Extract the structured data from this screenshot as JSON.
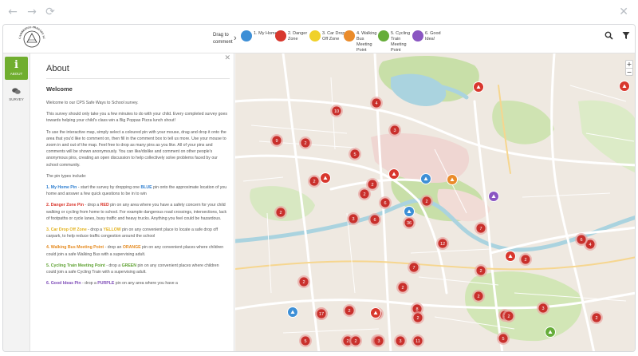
{
  "browser": {
    "back": "←",
    "forward": "→",
    "reload": "⟳",
    "close": "✕"
  },
  "header": {
    "logo_text": "CAMBRIDGE PRIMARY SCHOOL",
    "intro": "Drag to comment",
    "steps": [
      {
        "label": "1. My Home",
        "color": "#3d8fd6"
      },
      {
        "label": "2. Danger Zone",
        "color": "#d8372d"
      },
      {
        "label": "3. Car Drop Off Zone",
        "color": "#f0d12a"
      },
      {
        "label": "4. Walking Bus Meeting Point",
        "color": "#ea8b2a"
      },
      {
        "label": "5. Cycling Train Meeting Point",
        "color": "#66ad39"
      },
      {
        "label": "6. Good Idea!",
        "color": "#8a56c2"
      }
    ],
    "search_icon": "search-icon",
    "filter_icon": "filter-icon"
  },
  "sidebar": {
    "tabs": [
      {
        "label": "ABOUT",
        "icon": "info-icon"
      },
      {
        "label": "SURVEY",
        "icon": "chat-icon"
      }
    ]
  },
  "panel": {
    "close": "✕",
    "title": "About",
    "heading": "Welcome",
    "p1": "Welcome to our CPS Safe Ways to School survey.",
    "p2": "This survey should only take you a few minutes to do with your child. Every completed survey goes towards helping your child's class win a Big Poppas Pizza lunch shout!",
    "p3": "To use the interactive map, simply select a coloured pin with your mouse, drag and drop it onto the area that you'd like to comment on, then fill in the comment box to tell us more. Use your mouse to zoom in and out of the map. Feel free to drop as many pins as you like. All of your pins and comments will be shown anonymously. You can like/dislike and comment on other people's anonymous pins, creating an open discussion to help collectively solve problems faced by our school community.",
    "p4": "The pin types include:",
    "pins": [
      {
        "name": "1. My Home Pin",
        "color_word": "BLUE",
        "pre": " - start the survey by dropping one ",
        "post": " pin onto the approximate location of you home and answer a few quick questions to be in to win"
      },
      {
        "name": "2. Danger Zone Pin",
        "color_word": "RED",
        "pre": " - drop a ",
        "post": " pin on any area where you have a safety concern for your child walking or cycling from home to school. For example dangerous road crossings, intersections, lack of footpaths or cycle lanes, busy traffic and heavy trucks. Anything you feel could be hazardous."
      },
      {
        "name": "3. Car Drop Off Zone",
        "color_word": "YELLOW",
        "pre": " - drop a ",
        "post": " pin on any convenient place to locate a safe drop off carpark, to help reduce traffic congestion around the school"
      },
      {
        "name": "4. Walking Bus Meeting Point",
        "color_word": "ORANGE",
        "pre": " - drop an ",
        "post": " pin on any convenient places where children could join a safe Walking Bus with a supervising adult."
      },
      {
        "name": "5. Cycling Train Meeting Point",
        "color_word": "GREEN",
        "pre": " - drop a ",
        "post": " pin on any convenient places where children could join a safe Cycling Train with a supervising adult."
      },
      {
        "name": "6. Good Ideas Pin",
        "color_word": "PURPLE",
        "pre": " - drop a ",
        "post": " pin on any area where you have a"
      }
    ]
  },
  "map": {
    "zoom_in": "+",
    "zoom_out": "−",
    "clusters": [
      "10",
      "4",
      "9",
      "2",
      "5",
      "3",
      "2",
      "2",
      "2",
      "2",
      "3",
      "6",
      "6",
      "2",
      "36",
      "12",
      "7",
      "7",
      "4",
      "2",
      "8",
      "2",
      "17",
      "2",
      "11",
      "2",
      "2",
      "3",
      "2",
      "17",
      "5",
      "2",
      "2",
      "4",
      "11",
      "5",
      "2",
      "2",
      "2",
      "6",
      "2",
      "3",
      "3"
    ]
  },
  "colors": {
    "accent_green": "#70ae2f",
    "danger_red": "#c9302c",
    "map_green": "#c8dfa8",
    "water": "#aad3df"
  }
}
